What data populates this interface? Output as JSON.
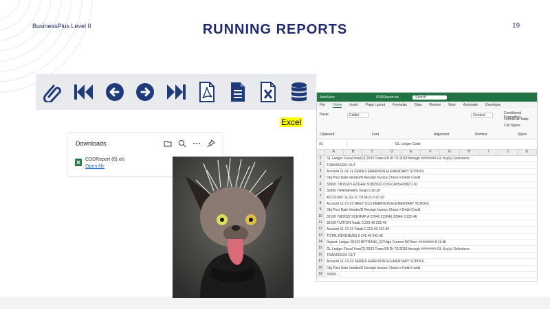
{
  "slide": {
    "brand": "BusinessPlus Level II",
    "title": "RUNNING  REPORTS",
    "page_number": "19"
  },
  "toolbar": {
    "buttons": [
      {
        "name": "attach",
        "icon": "paperclip-icon"
      },
      {
        "name": "first",
        "icon": "skip-first-icon"
      },
      {
        "name": "previous",
        "icon": "arrow-left-circle-icon"
      },
      {
        "name": "next",
        "icon": "arrow-right-circle-icon"
      },
      {
        "name": "last",
        "icon": "skip-last-icon"
      },
      {
        "name": "pdf",
        "icon": "pdf-file-icon"
      },
      {
        "name": "document",
        "icon": "document-icon"
      },
      {
        "name": "excel",
        "icon": "excel-file-icon"
      },
      {
        "name": "database",
        "icon": "database-icon"
      }
    ],
    "icon_color": "#1f3a78"
  },
  "excel_callout": "Excel",
  "downloads": {
    "title": "Downloads",
    "file_name": "CDDReport (6).xls",
    "open_link": "Open file"
  },
  "excel_window": {
    "autosave": "AutoSave",
    "filename": "CDDReport.xls",
    "search": "Search",
    "menu": [
      "File",
      "Home",
      "Insert",
      "Page Layout",
      "Formulas",
      "Data",
      "Review",
      "View",
      "Automate",
      "Developer"
    ],
    "active_menu": "Home",
    "ribbon_groups": [
      "Clipboard",
      "Font",
      "Alignment",
      "Number",
      "Styles"
    ],
    "ribbon_items": [
      "Paste",
      "Calibri",
      "General",
      "Conditional Formatting",
      "Format as Table",
      "Cell Styles"
    ],
    "name_box": "A1",
    "formula": "GL Ledger Code",
    "columns": [
      "A",
      "B",
      "C",
      "D",
      "E",
      "F",
      "G",
      "H",
      "I",
      "J",
      "K"
    ],
    "rows": [
      {
        "n": "1",
        "text": "GL Ledger  Fiscal Year(O)          2023          Trans Eff Dt  7/1/2018 through    ########  GL Key(s) Selections"
      },
      {
        "n": "2",
        "text": "TRANSFERS OUT"
      },
      {
        "n": "3",
        "text": "Account  11-31-11 SERIES EMERSON ELEMENTARY SCHOOL"
      },
      {
        "n": "4",
        "text": "Obj      Post Date  Vendor/D Receipt   Invoice   Check #   Debit     Credit"
      },
      {
        "n": "5",
        "text": "   32600  7/8/2022  LEDGER 3/18/2022  CDD-CR0542082                    0        20"
      },
      {
        "n": "6",
        "text": "   32600  TRANSFERS Totals                 0        20        20"
      },
      {
        "n": "7",
        "text": "ACCOUNT    11-31-11 TOTALS                  0        20        20"
      },
      {
        "n": "8",
        "text": "Account  11-73-22 MEET OLD EMERSON ELEMENTARY SCHOOL"
      },
      {
        "n": "9",
        "text": "Obj      Post Date  Vendor/D Receipt   Invoice   Check #   Debit     Credit"
      },
      {
        "n": "10",
        "text": "   32100  7/8/2022  SCRHMP A     22946    222646     22946      0      222.46"
      },
      {
        "n": "11",
        "text": "   32100  TUITION Totals                   0      222.46    222.46"
      },
      {
        "n": "12",
        "text": "Account  11-73-22 Totals                  0      222.46    222.46"
      },
      {
        "n": "13",
        "text": "TOTAL     REVENUES         0      242.46     242.46"
      },
      {
        "n": "14",
        "text": "Report:  Ledger    00333   BPTRANS_EFFdge          Current Dt/Time:  ########  8:11:48"
      },
      {
        "n": "15",
        "text": "GL Ledger  Fiscal Year(O)      2023          Trans Eff Dt  7/1/2018 through    ########  GL Key(s) Selections"
      },
      {
        "n": "16",
        "text": "TRANSFERS OUT"
      },
      {
        "n": "17",
        "text": "Account  11-73-22 SERIES EMERSON ELEMENTARY SCHOOL"
      },
      {
        "n": "18",
        "text": "Obj      Post Date  Vendor/D Receipt   Invoice   Check #   Debit     Credit"
      },
      {
        "n": "19",
        "text": "   32000  ..."
      }
    ]
  },
  "colors": {
    "title": "#1f2a6e",
    "toolbar_bg": "#e8eaee",
    "excel_green": "#217346",
    "callout_highlight": "#ffff00"
  }
}
